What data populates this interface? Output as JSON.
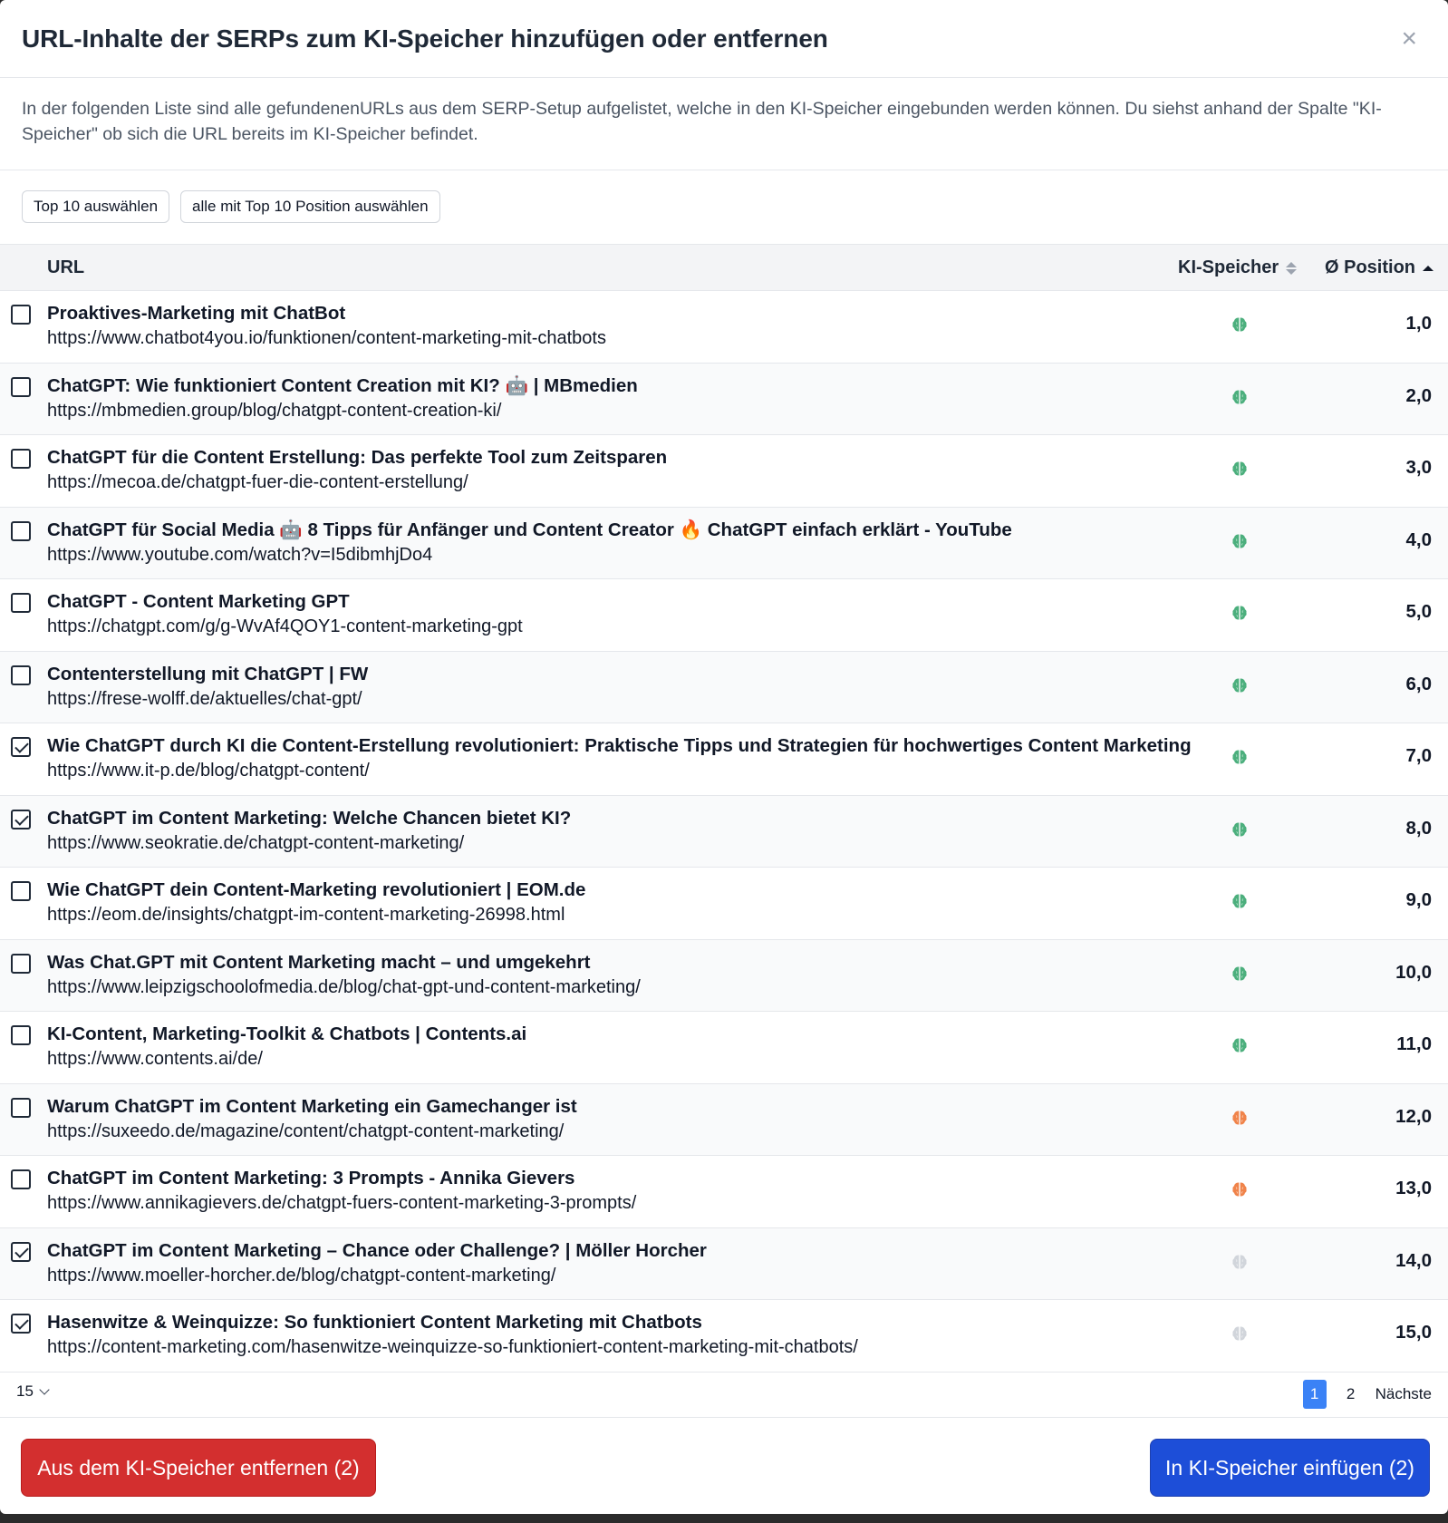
{
  "dialog": {
    "title": "URL-Inhalte der SERPs zum KI-Speicher hinzufügen oder entfernen",
    "close_symbol": "×",
    "description": "In der folgenden Liste sind alle gefundenenURLs aus dem SERP-Setup aufgelistet, welche in den KI-Speicher eingebunden werden können. Du siehst anhand der Spalte \"KI-Speicher\" ob sich die URL bereits im KI-Speicher befindet."
  },
  "actions": {
    "top10": "Top 10 auswählen",
    "top10_position": "alle mit Top 10 Position auswählen"
  },
  "table": {
    "headers": {
      "url": "URL",
      "ki": "KI-Speicher",
      "position": "Ø Position"
    },
    "rows": [
      {
        "title": "Proaktives-Marketing mit ChatBot",
        "url": "https://www.chatbot4you.io/funktionen/content-marketing-mit-chatbots",
        "position": "1,0",
        "checked": false,
        "ki_status": "green"
      },
      {
        "title": "ChatGPT: Wie funktioniert Content Creation mit KI? 🤖 | MBmedien",
        "url": "https://mbmedien.group/blog/chatgpt-content-creation-ki/",
        "position": "2,0",
        "checked": false,
        "ki_status": "green"
      },
      {
        "title": "ChatGPT für die Content Erstellung: Das perfekte Tool zum Zeitsparen",
        "url": "https://mecoa.de/chatgpt-fuer-die-content-erstellung/",
        "position": "3,0",
        "checked": false,
        "ki_status": "green"
      },
      {
        "title": "ChatGPT für Social Media 🤖 8 Tipps für Anfänger und Content Creator 🔥 ChatGPT einfach erklärt - YouTube",
        "url": "https://www.youtube.com/watch?v=I5dibmhjDo4",
        "position": "4,0",
        "checked": false,
        "ki_status": "green"
      },
      {
        "title": "ChatGPT - Content Marketing GPT",
        "url": "https://chatgpt.com/g/g-WvAf4QOY1-content-marketing-gpt",
        "position": "5,0",
        "checked": false,
        "ki_status": "green"
      },
      {
        "title": "Contenterstellung mit ChatGPT | FW",
        "url": "https://frese-wolff.de/aktuelles/chat-gpt/",
        "position": "6,0",
        "checked": false,
        "ki_status": "green"
      },
      {
        "title": "Wie ChatGPT durch KI die Content-Erstellung revolutioniert: Praktische Tipps und Strategien für hochwertiges Content Marketing",
        "url": "https://www.it-p.de/blog/chatgpt-content/",
        "position": "7,0",
        "checked": true,
        "ki_status": "green"
      },
      {
        "title": "ChatGPT im Content Marketing: Welche Chancen bietet KI?",
        "url": "https://www.seokratie.de/chatgpt-content-marketing/",
        "position": "8,0",
        "checked": true,
        "ki_status": "green"
      },
      {
        "title": "Wie ChatGPT dein Content-Marketing revolutioniert | EOM.de",
        "url": "https://eom.de/insights/chatgpt-im-content-marketing-26998.html",
        "position": "9,0",
        "checked": false,
        "ki_status": "green"
      },
      {
        "title": "Was Chat.GPT mit Content Marketing macht – und umgekehrt",
        "url": "https://www.leipzigschoolofmedia.de/blog/chat-gpt-und-content-marketing/",
        "position": "10,0",
        "checked": false,
        "ki_status": "green"
      },
      {
        "title": "KI-Content, Marketing-Toolkit & Chatbots | Contents.ai",
        "url": "https://www.contents.ai/de/",
        "position": "11,0",
        "checked": false,
        "ki_status": "green"
      },
      {
        "title": "Warum ChatGPT im Content Marketing ein Gamechanger ist",
        "url": "https://suxeedo.de/magazine/content/chatgpt-content-marketing/",
        "position": "12,0",
        "checked": false,
        "ki_status": "orange"
      },
      {
        "title": "ChatGPT im Content Marketing: 3 Prompts - Annika Gievers",
        "url": "https://www.annikagievers.de/chatgpt-fuers-content-marketing-3-prompts/",
        "position": "13,0",
        "checked": false,
        "ki_status": "orange"
      },
      {
        "title": "ChatGPT im Content Marketing – Chance oder Challenge? | Möller Horcher",
        "url": "https://www.moeller-horcher.de/blog/chatgpt-content-marketing/",
        "position": "14,0",
        "checked": true,
        "ki_status": "gray"
      },
      {
        "title": "Hasenwitze & Weinquizze: So funktioniert Content Marketing mit Chatbots",
        "url": "https://content-marketing.com/hasenwitze-weinquizze-so-funktioniert-content-marketing-mit-chatbots/",
        "position": "15,0",
        "checked": true,
        "ki_status": "gray"
      }
    ]
  },
  "pagination": {
    "per_page": "15",
    "pages": [
      "1",
      "2"
    ],
    "active": "1",
    "next": "Nächste"
  },
  "buttons": {
    "remove": "Aus dem KI-Speicher entfernen (2)",
    "add": "In KI-Speicher einfügen (2)"
  },
  "colors": {
    "green": "#4caf7d",
    "orange": "#f0834a",
    "gray": "#d1d5db",
    "remove_btn": "#d32f2f",
    "add_btn": "#1d4ed8",
    "active_page": "#3b82f6"
  },
  "icons": {
    "row_status": "brain-icon",
    "close": "close-icon",
    "sort": "sort-icon",
    "chevron": "chevron-down-icon"
  }
}
